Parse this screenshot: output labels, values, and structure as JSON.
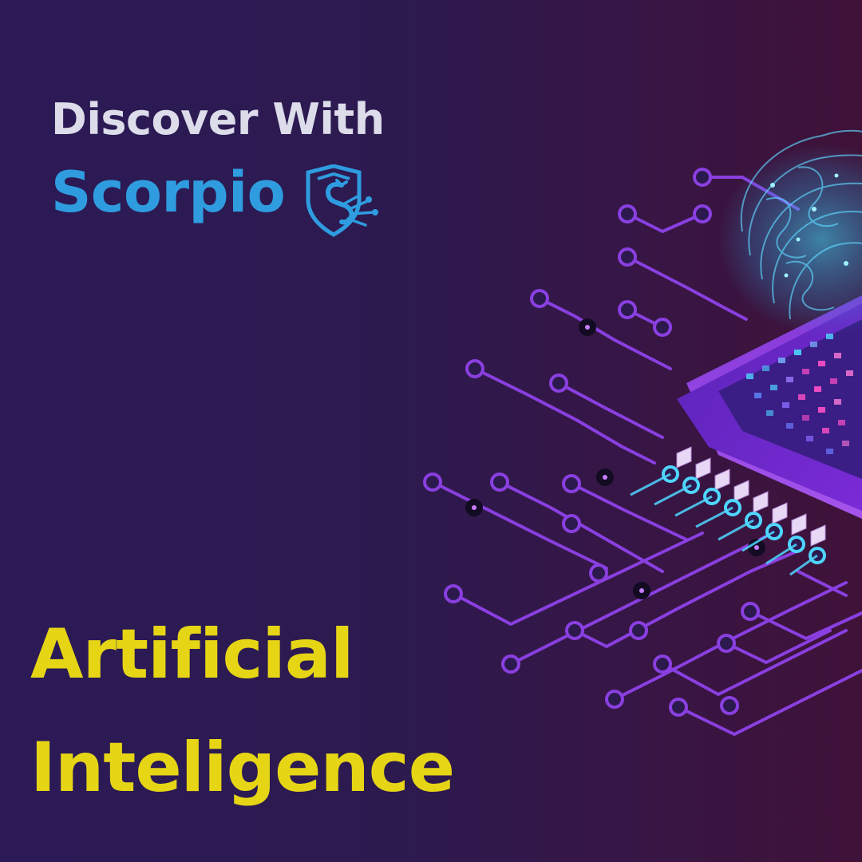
{
  "heading": {
    "line1": "Discover With",
    "brand": "Scorpio"
  },
  "logo": {
    "icon": "scorpion-shield-icon"
  },
  "title": {
    "line1": "Artificial",
    "line2": "Inteligence"
  },
  "illustration": {
    "icon": "ai-chip-brain-circuit-illustration"
  },
  "colors": {
    "background_start": "#2b1a56",
    "background_end": "#3f1238",
    "heading": "#dcdcea",
    "brand": "#2f9ce0",
    "title": "#e6d515",
    "circuit": "#8a3fe0",
    "circuit_highlight": "#4fd6ff",
    "chip_pixel_pink": "#ff4fc8"
  }
}
